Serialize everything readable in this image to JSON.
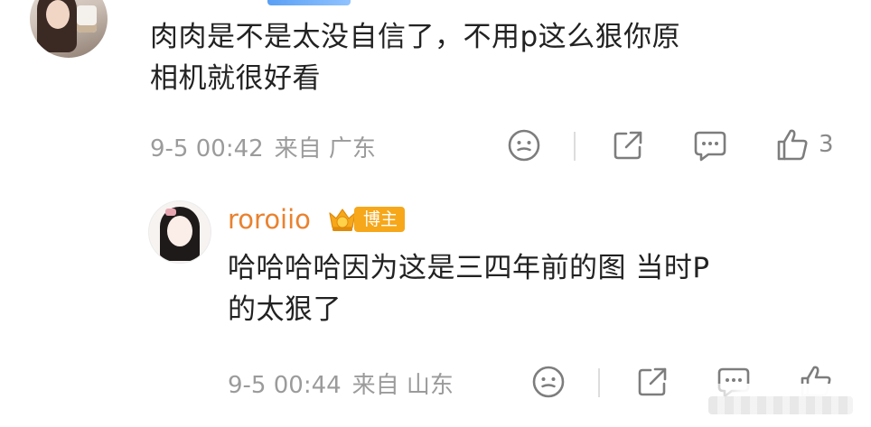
{
  "main_comment": {
    "text_line1": "肉肉是不是太没自信了，不用p这么狠你原",
    "text_line2": "相机就很好看",
    "timestamp": "9-5 00:42",
    "location": "来自 广东",
    "like_count": "3"
  },
  "reply": {
    "username": "roroiio",
    "role_badge": "博主",
    "text_line1": "哈哈哈哈因为这是三四年前的图 当时P",
    "text_line2": "的太狠了",
    "timestamp": "9-5 00:44",
    "location": "来自 山东"
  },
  "colors": {
    "username": "#e9822f",
    "badge": "#f6a71a",
    "meta_text": "#9b9b9b",
    "body_text": "#222222"
  },
  "icons": [
    "smile-icon",
    "share-icon",
    "comment-icon",
    "like-icon"
  ]
}
